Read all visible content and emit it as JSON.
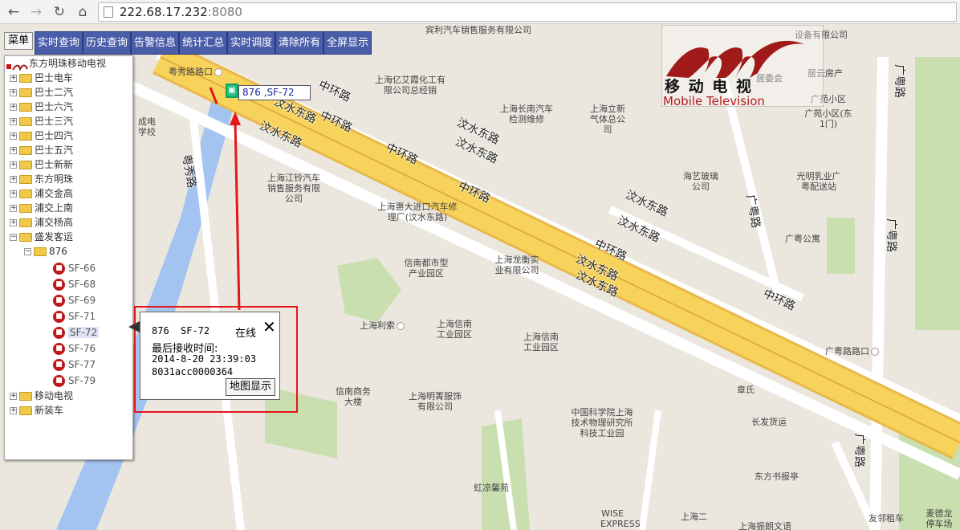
{
  "browser": {
    "url_host": "222.68.17.232",
    "url_port": ":8080",
    "back_icon": "back-arrow-icon",
    "forward_icon": "forward-arrow-icon",
    "reload_icon": "reload-icon",
    "home_icon": "home-icon"
  },
  "toolbar": {
    "menu_label": "菜单",
    "buttons": [
      "实时查询",
      "历史查询",
      "告警信息",
      "统计汇总",
      "实时调度",
      "清除所有",
      "全屏显示"
    ]
  },
  "tree": {
    "root": "东方明珠移动电视",
    "groups": [
      "巴士电车",
      "巴士二汽",
      "巴士六汽",
      "巴士三汽",
      "巴士四汽",
      "巴士五汽",
      "巴士新新",
      "东方明珠",
      "浦交金高",
      "浦交上南",
      "浦交杨高",
      "盛发客运"
    ],
    "subgroup": "876",
    "vehicles": [
      "SF-66",
      "SF-68",
      "SF-69",
      "SF-71",
      "SF-72",
      "SF-76",
      "SF-77",
      "SF-79"
    ],
    "selected_vehicle": "SF-72",
    "tail_groups": [
      "移动电视",
      "新装车"
    ]
  },
  "popup": {
    "line": "876",
    "vehicle": "SF-72",
    "status": "在线",
    "last_time_label": "最后接收时间:",
    "last_time": "2014-8-20 23:39:03",
    "device_id": "8031acc0000364",
    "map_button": "地图显示"
  },
  "vehicle_marker": {
    "label": "876 ,SF-72"
  },
  "logo": {
    "cn": "移 动 电 视",
    "en": "Mobile Television"
  },
  "map_labels": {
    "roads": {
      "zhonghuan": "中环路",
      "wenshui_east": "汶水东路",
      "yuexiu": "粤秀路",
      "guangyue": "广粤路",
      "guangyue_road_junction": "广粤路路口",
      "yuexiu_junction": "粤秀路路口"
    },
    "pois": {
      "yiai": "上海亿艾霞化工有限公司总经销",
      "binli": "宾利汽车销售服务有限公司",
      "changnan": "上海长南汽车检测维修",
      "lixin": "上海立新气体总公司",
      "jiangling": "上海江铃汽车销售服务有限公司",
      "huida": "上海惠大进口汽车修理厂(汶水东路)",
      "xinnan_park": "信南都市型产业园区",
      "longheng": "上海龙衡实业有限公司",
      "lisuo": "上海利索",
      "xinnan_ind": "上海信南工业园区",
      "xinnan_ind2": "上海信南工业园区",
      "xinnan_bldg": "信南商务大楼",
      "mingqing": "上海明菁服饰有限公司",
      "cas": "中国科学院上海技术物理研究所科技工业园",
      "hongliang": "虹凉馨苑",
      "haiyi": "海艺玻璃公司",
      "guangming": "光明乳业广粤配送站",
      "guangyue_apt": "广粤公寓",
      "guangyuan": "广苑小区",
      "guangyuan2": "广苑小区(东1门)",
      "juyun": "居云房产",
      "zhangshi": "章氏",
      "changfa": "长发货运",
      "dongfang": "东方书报亭",
      "youlin": "友邻租车",
      "wise": "WISE EXPRESS",
      "chengdian": "成电学校",
      "equipment": "设备有限公司",
      "committee": "居委会",
      "shanghai_bldg": "上海二",
      "zhenming": "上海振朗文语",
      "menggu": "麦德龙停车场",
      "guangyuan3": "广粤路路口"
    }
  },
  "colors": {
    "toolbar_bg": "#4a5da8",
    "highway": "#f7d35b",
    "alert_red": "#e3161a",
    "bus_red": "#c01818"
  }
}
